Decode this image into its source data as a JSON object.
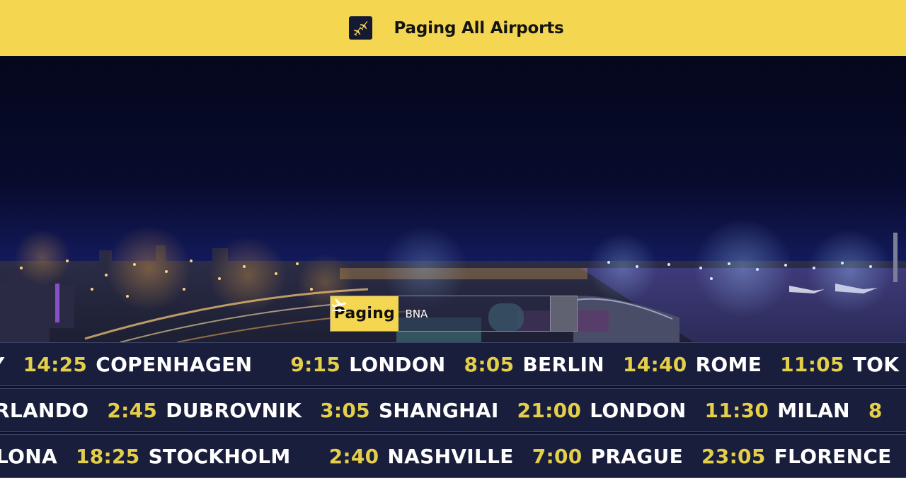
{
  "header": {
    "title": "Paging All Airports",
    "logo_icon": "airplanes-icon",
    "background": "#f5d650"
  },
  "search": {
    "label": "Paging",
    "value": "BNA",
    "submit_icon": "plane-takeoff-icon"
  },
  "board": {
    "time_color": "#e4cf48",
    "rows": [
      {
        "entries": [
          {
            "time": "",
            "city": "Y"
          },
          {
            "time": "14:25",
            "city": "COPENHAGEN"
          },
          {
            "time": "9:15",
            "city": "LONDON"
          },
          {
            "time": "8:05",
            "city": "BERLIN"
          },
          {
            "time": "14:40",
            "city": "ROME"
          },
          {
            "time": "11:05",
            "city": "TOK"
          }
        ]
      },
      {
        "entries": [
          {
            "time": "",
            "city": "RLANDO"
          },
          {
            "time": "2:45",
            "city": "DUBROVNIK"
          },
          {
            "time": "3:05",
            "city": "SHANGHAI"
          },
          {
            "time": "21:00",
            "city": "LONDON"
          },
          {
            "time": "11:30",
            "city": "MILAN"
          },
          {
            "time": "8",
            "city": ""
          }
        ]
      },
      {
        "entries": [
          {
            "time": "",
            "city": "LONA"
          },
          {
            "time": "18:25",
            "city": "STOCKHOLM"
          },
          {
            "time": "2:40",
            "city": "NASHVILLE"
          },
          {
            "time": "7:00",
            "city": "PRAGUE"
          },
          {
            "time": "23:05",
            "city": "FLORENCE"
          }
        ]
      }
    ]
  }
}
